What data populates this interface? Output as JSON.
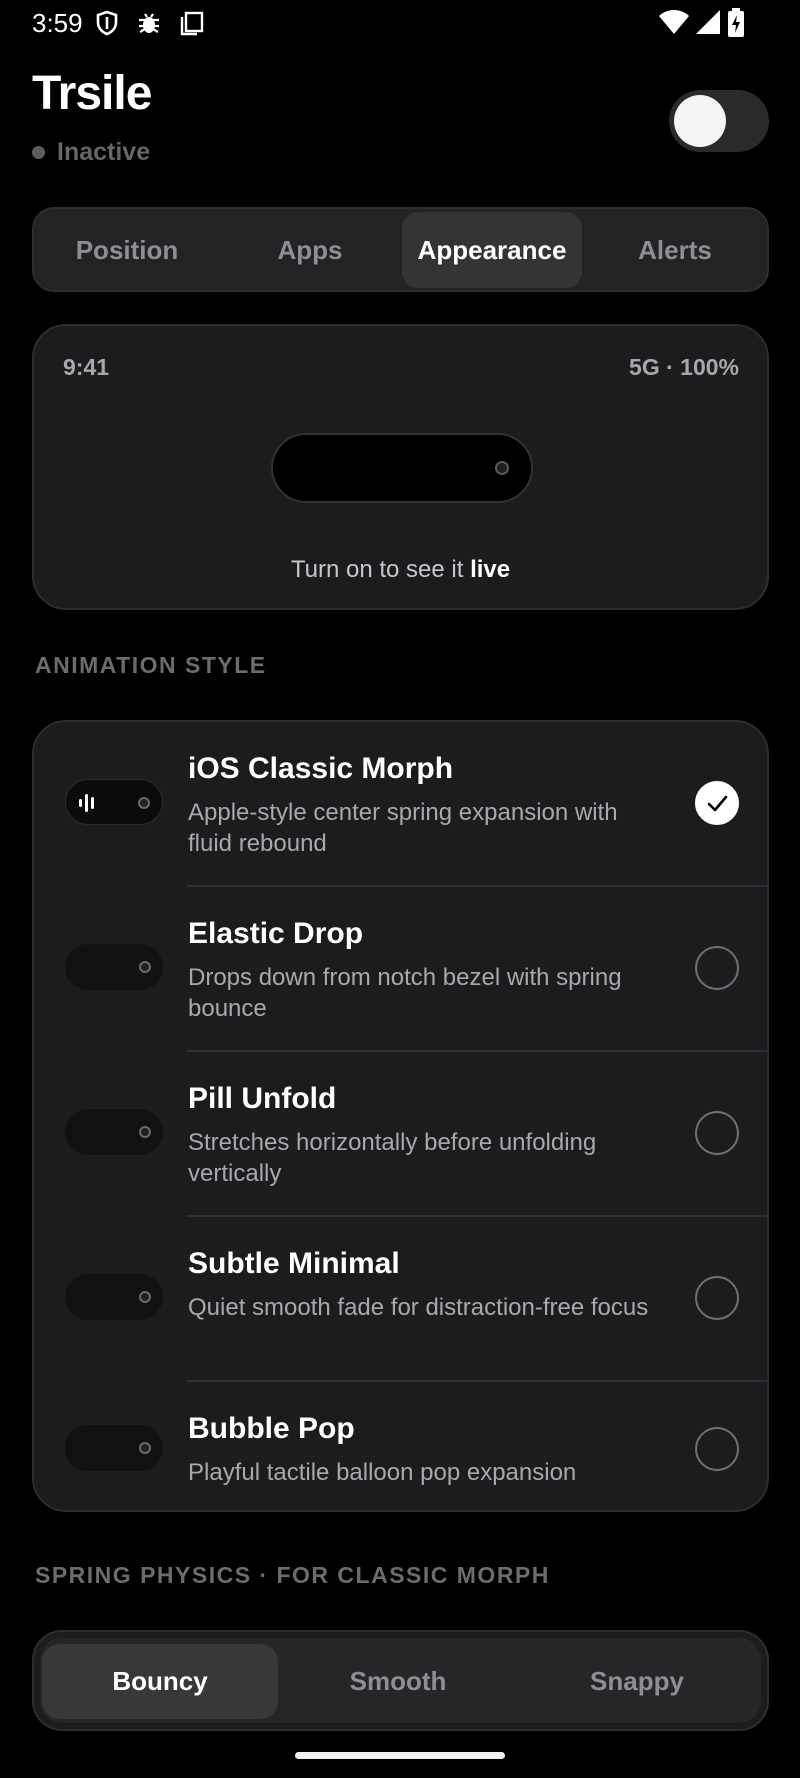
{
  "status_bar": {
    "time": "3:59",
    "left_icons": [
      "shield-icon",
      "bug-icon",
      "copy-icon"
    ],
    "right_icons": [
      "wifi-icon",
      "cell-signal-icon",
      "battery-charging-icon"
    ]
  },
  "header": {
    "title": "Trsile",
    "status": "Inactive",
    "toggle_on": false
  },
  "tabs": [
    {
      "label": "Position",
      "active": false
    },
    {
      "label": "Apps",
      "active": false
    },
    {
      "label": "Appearance",
      "active": true
    },
    {
      "label": "Alerts",
      "active": false
    }
  ],
  "preview": {
    "time": "9:41",
    "network": "5G · 100%",
    "hint_prefix": "Turn on to see it",
    "hint_emphasis": "live"
  },
  "animation_section": {
    "label": "ANIMATION STYLE",
    "items": [
      {
        "title": "iOS Classic Morph",
        "desc": "Apple-style center spring expansion with fluid rebound",
        "selected": true
      },
      {
        "title": "Elastic Drop",
        "desc": "Drops down from notch bezel with spring bounce",
        "selected": false
      },
      {
        "title": "Pill Unfold",
        "desc": "Stretches horizontally before unfolding vertically",
        "selected": false
      },
      {
        "title": "Subtle Minimal",
        "desc": "Quiet smooth fade for distraction-free focus",
        "selected": false
      },
      {
        "title": "Bubble Pop",
        "desc": "Playful tactile balloon pop expansion",
        "selected": false
      }
    ]
  },
  "physics_section": {
    "label": "SPRING PHYSICS · FOR CLASSIC MORPH",
    "options": [
      {
        "label": "Bouncy",
        "active": true
      },
      {
        "label": "Smooth",
        "active": false
      },
      {
        "label": "Snappy",
        "active": false
      }
    ]
  },
  "colors": {
    "background": "#000000",
    "card": "#1c1c1e",
    "selected_tab": "#343437",
    "muted_text": "#8e8e93"
  }
}
